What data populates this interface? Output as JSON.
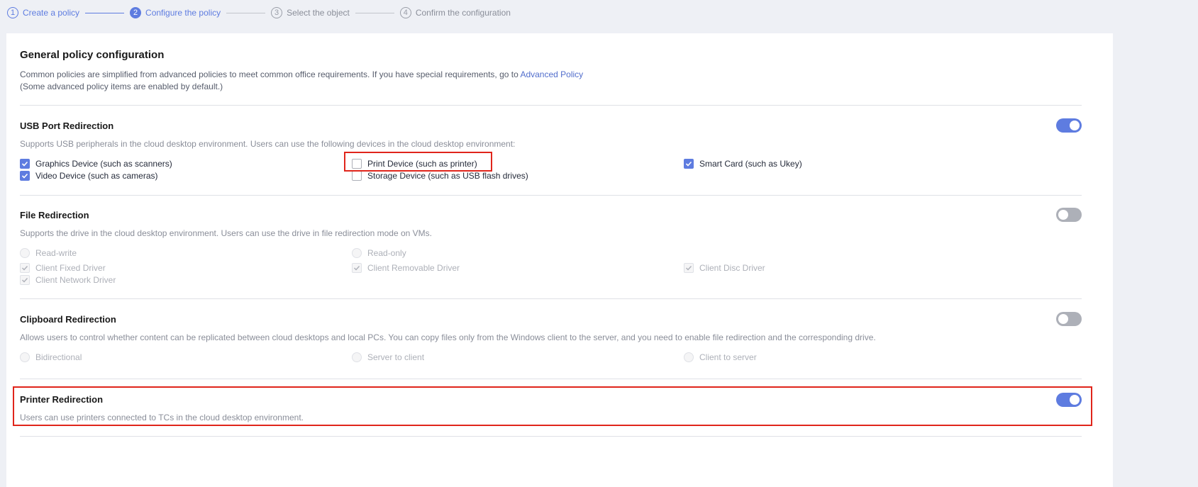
{
  "steps": [
    {
      "num": "1",
      "label": "Create a policy",
      "state": "done"
    },
    {
      "num": "2",
      "label": "Configure the policy",
      "state": "active"
    },
    {
      "num": "3",
      "label": "Select the object",
      "state": "todo"
    },
    {
      "num": "4",
      "label": "Confirm the configuration",
      "state": "todo"
    }
  ],
  "general": {
    "title": "General policy configuration",
    "desc_prefix": "Common policies are simplified from advanced policies to meet common office requirements. If you have special requirements, go to ",
    "desc_link": "Advanced Policy",
    "desc_note": "(Some advanced policy items are enabled by default.)"
  },
  "usb": {
    "title": "USB Port Redirection",
    "desc": "Supports USB peripherals in the cloud desktop environment. Users can use the following devices in the cloud desktop environment:",
    "enabled": true,
    "options": {
      "graphics": {
        "label": "Graphics Device (such as scanners)",
        "checked": true
      },
      "video": {
        "label": "Video Device (such as cameras)",
        "checked": true
      },
      "print": {
        "label": "Print Device (such as printer)",
        "checked": false
      },
      "storage": {
        "label": "Storage Device (such as USB flash drives)",
        "checked": false
      },
      "smartcard": {
        "label": "Smart Card (such as Ukey)",
        "checked": true
      }
    }
  },
  "file": {
    "title": "File Redirection",
    "desc": "Supports the drive in the cloud desktop environment. Users can use the drive in file redirection mode on VMs.",
    "enabled": false,
    "modes": {
      "read_write": "Read-write",
      "read_only": "Read-only"
    },
    "drivers": {
      "fixed": "Client Fixed Driver",
      "removable": "Client Removable Driver",
      "disc": "Client Disc Driver",
      "network": "Client Network Driver"
    }
  },
  "clipboard": {
    "title": "Clipboard Redirection",
    "desc": "Allows users to control whether content can be replicated between cloud desktops and local PCs. You can copy files only from the Windows client to the server, and you need to enable file redirection and the corresponding drive.",
    "enabled": false,
    "options": {
      "bidirectional": "Bidirectional",
      "server_to_client": "Server to client",
      "client_to_server": "Client to server"
    }
  },
  "printer": {
    "title": "Printer Redirection",
    "desc": "Users can use printers connected to TCs in the cloud desktop environment.",
    "enabled": true
  },
  "colors": {
    "accent": "#5e7ce0",
    "highlight": "#e0251b",
    "disabled": "#adb0b8"
  }
}
